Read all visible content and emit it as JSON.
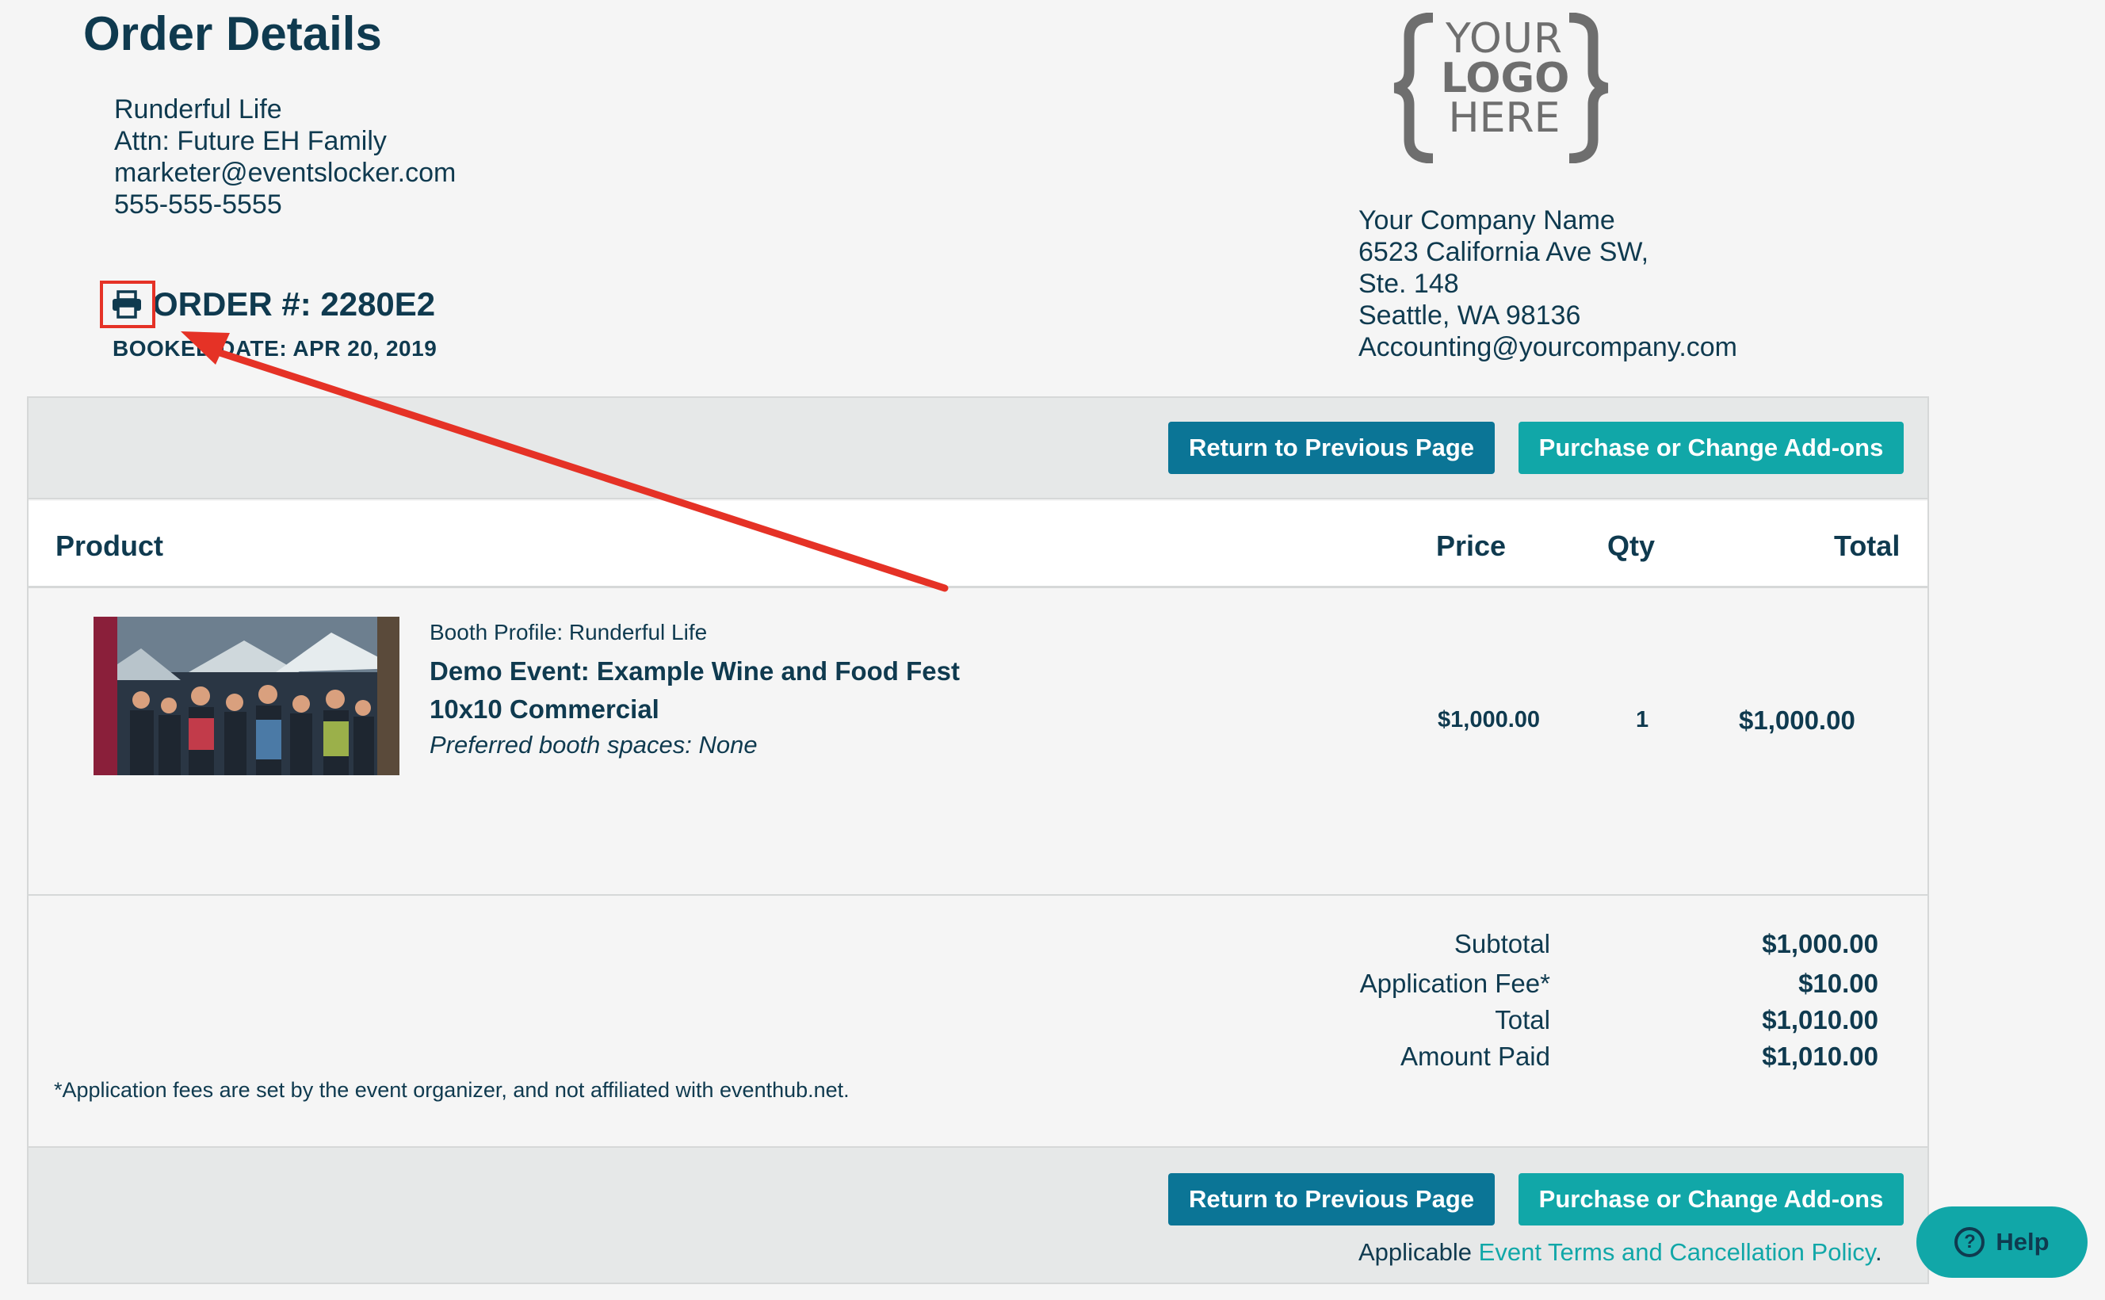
{
  "header": {
    "title": "Order Details",
    "buyer": {
      "name": "Runderful Life",
      "attn": "Attn: Future EH Family",
      "email": "marketer@eventslocker.com",
      "phone": "555-555-5555"
    },
    "order_number": "ORDER #: 2280E2",
    "booked_date": "BOOKED DATE: APR 20, 2019"
  },
  "logo": {
    "line1": "YOUR",
    "line2": "LOGO",
    "line3": "HERE"
  },
  "company": {
    "name": "Your Company Name",
    "address1": "6523 California Ave SW,",
    "address2": "Ste. 148",
    "city": "Seattle, WA 98136",
    "email": "Accounting@yourcompany.com"
  },
  "toolbar": {
    "return_label": "Return to Previous Page",
    "addons_label": "Purchase or Change Add-ons"
  },
  "table": {
    "columns": [
      "Product",
      "Price",
      "Qty",
      "Total"
    ],
    "rows": [
      {
        "booth_profile": "Booth Profile: Runderful Life",
        "event": "Demo Event: Example Wine and Food Fest",
        "booth_size": "10x10 Commercial",
        "preferences": "Preferred booth spaces: None",
        "price": "$1,000.00",
        "qty": "1",
        "total": "$1,000.00"
      }
    ]
  },
  "summary": {
    "subtotal_label": "Subtotal",
    "subtotal": "$1,000.00",
    "fee_label": "Application Fee*",
    "fee": "$10.00",
    "total_label": "Total",
    "total": "$1,010.00",
    "paid_label": "Amount Paid",
    "paid": "$1,010.00"
  },
  "footnote": "*Application fees are set by the event organizer, and not affiliated with eventhub.net.",
  "terms": {
    "prefix": "Applicable ",
    "link": "Event Terms and Cancellation Policy",
    "suffix": "."
  },
  "help": {
    "label": "Help"
  },
  "colors": {
    "primary_dark": "#0b7596",
    "teal": "#11a7a8",
    "text": "#0f3a4f",
    "annotation": "#e53226"
  },
  "icons": [
    "print-icon",
    "help-icon",
    "logo-braces"
  ]
}
